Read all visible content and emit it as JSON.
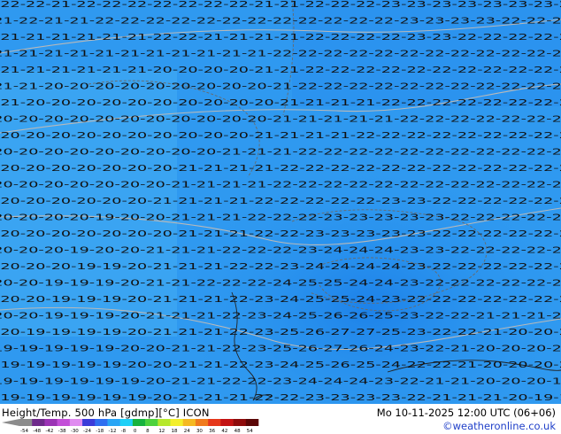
{
  "header": {
    "title": "Height/Temp. 500 hPa [gdmp][°C] ICON",
    "valid": "Mo 10-11-2025 12:00 UTC (06+06)",
    "credit": "©weatheronline.co.uk"
  },
  "colorbar": {
    "labels": [
      "-54",
      "-48",
      "-42",
      "-38",
      "-30",
      "-24",
      "-18",
      "-12",
      "-8",
      "0",
      "8",
      "12",
      "18",
      "24",
      "30",
      "36",
      "42",
      "48",
      "54"
    ],
    "colors": [
      "#8c8c8c",
      "#6e2a8a",
      "#9b33b5",
      "#c34fd8",
      "#e08cf0",
      "#3b3bd9",
      "#2f6ff0",
      "#29a5f5",
      "#1fd0f7",
      "#16b33e",
      "#4cd23c",
      "#b6e82c",
      "#f3ef2c",
      "#f5b921",
      "#f07a1c",
      "#e5371a",
      "#c31212",
      "#8e0b0b",
      "#5a0606"
    ]
  },
  "map": {
    "colors": {
      "cold": "#1e8df0",
      "mid": "#3aa4f2",
      "warm": "#55bff5",
      "contour": "#b9b9b9",
      "isotherm": "#6a6a6a",
      "coast": "#222222",
      "number": "#111111"
    },
    "number_rows": [
      "-22-22-21-22-22-22-22-22-22-22-21-21-22-22-22-23-23-23-23-23-23-23-23",
      "-21-22-21-21-22-22-22-22-22-22-22-22-22-22-22-22-23-23-23-23-22-22-22",
      "-21-21-21-21-21-21-22-22-21-21-21-21-22-22-22-22-23-23-22-22-22-22-22",
      "-21-21-21-21-21-21-21-21-21-21-21-22-22-22-22-22-22-22-22-22-22-22-22",
      "-21-21-21-21-21-21-20-20-20-20-21-21-22-22-22-22-22-22-22-22-22-22-21",
      "-21-21-20-20-20-20-20-20-20-20-20-21-22-22-22-22-22-22-22-22-22-22-21",
      "-21-20-20-20-20-20-20-20-20-20-20-21-21-21-21-22-22-22-22-22-22-22-22",
      "-20-20-20-20-20-20-20-20-20-20-20-21-21-21-21-21-22-22-22-22-22-22-22",
      "-20-20-20-20-20-20-20-20-20-20-21-21-21-21-22-22-22-22-22-22-22-22-22",
      "-20-20-20-20-20-20-20-20-20-21-21-21-22-22-22-22-22-22-22-22-22-22-22",
      "-20-20-20-20-20-20-20-21-21-21-21-22-22-22-22-22-22-22-22-22-22-22-22",
      "-20-20-20-20-20-20-20-21-21-21-21-22-22-22-22-22-22-22-22-22-22-22-22",
      "-20-20-20-20-20-20-21-21-21-21-22-22-22-22-22-23-23-22-22-22-22-22-22",
      "-20-20-20-20-19-20-20-21-21-21-22-22-22-23-23-23-23-23-22-22-22-22-22",
      "-20-20-20-20-20-20-20-21-21-21-22-22-23-23-23-23-23-22-22-22-22-22-22",
      "-20-20-20-19-20-20-21-21-21-22-22-22-23-24-24-24-23-23-22-22-22-22-22",
      "-20-20-20-19-19-20-21-21-21-22-22-23-24-24-24-24-23-22-22-22-22-22-22",
      "-20-20-19-19-19-20-21-21-22-22-22-24-25-25-24-24-23-22-22-22-22-22-22",
      "-20-20-19-19-19-20-21-21-21-22-23-24-25-25-24-23-22-22-22-22-22-22-21",
      "-20-20-19-19-19-20-21-21-21-22-23-24-25-26-26-25-23-22-22-21-21-21-21",
      "-20-19-19-19-19-20-21-21-21-22-23-25-26-27-27-25-23-22-22-21-20-20-20",
      "-19-19-19-19-19-20-20-21-21-22-23-25-26-27-26-24-23-22-21-20-20-20-20",
      "-19-19-19-19-19-20-20-21-21-22-23-24-25-26-25-24-22-22-21-20-20-20-20",
      "-19-19-19-19-19-19-20-21-21-22-22-23-24-24-24-23-22-21-21-20-20-20-19",
      "-19-19-19-19-19-19-20-21-21-21-22-22-23-23-23-23-22-21-21-21-20-19-19"
    ]
  }
}
